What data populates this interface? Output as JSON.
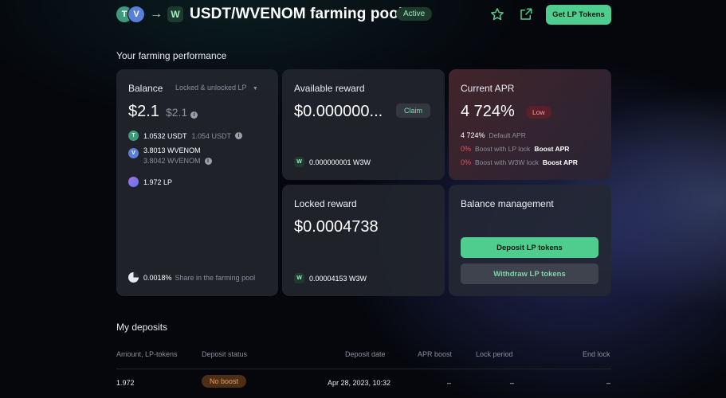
{
  "header": {
    "token_a": "T",
    "token_b": "V",
    "token_target": "W",
    "title": "USDT/WVENOM farming pool",
    "status": "Active",
    "get_lp_label": "Get LP Tokens",
    "icons": [
      "star-icon",
      "external-link-icon"
    ]
  },
  "performance": {
    "section_title": "Your farming performance",
    "balance": {
      "title": "Balance",
      "filter_label": "Locked & unlocked LP",
      "value": "$2.1",
      "value_secondary": "$2.1",
      "usdt_amount": "1.0532 USDT",
      "usdt_secondary": "1.054 USDT",
      "wvenom_amount": "3.8013 WVENOM",
      "wvenom_secondary": "3.8042 WVENOM",
      "lp_amount": "1.972 LP",
      "share_value": "0.0018%",
      "share_label": "Share in the farming pool"
    },
    "available_reward": {
      "title": "Available reward",
      "value": "$0.000000...",
      "claim_label": "Claim",
      "token_amount": "0.000000001 W3W"
    },
    "current_apr": {
      "title": "Current APR",
      "value": "4 724%",
      "level": "Low",
      "default_value": "4 724%",
      "default_label": "Default APR",
      "lp_boost_value": "0%",
      "lp_boost_label": "Boost with LP lock",
      "lp_boost_link": "Boost APR",
      "w3w_boost_value": "0%",
      "w3w_boost_label": "Boost with W3W lock",
      "w3w_boost_link": "Boost APR"
    },
    "locked_reward": {
      "title": "Locked reward",
      "value": "$0.0004738",
      "token_amount": "0.00004153 W3W"
    },
    "balance_management": {
      "title": "Balance management",
      "deposit_label": "Deposit LP tokens",
      "withdraw_label": "Withdraw LP tokens"
    }
  },
  "deposits": {
    "section_title": "My deposits",
    "columns": [
      "Amount, LP-tokens",
      "Deposit status",
      "Deposit date",
      "APR boost",
      "Lock period",
      "End lock"
    ],
    "rows": [
      {
        "amount": "1.972",
        "status": "No boost",
        "date": "Apr 28, 2023, 10:32",
        "apr_boost": "–",
        "lock_period": "–",
        "end_lock": "–"
      }
    ]
  },
  "colors": {
    "accent": "#4fcd8f",
    "card": "#22252c",
    "danger": "#e0525f"
  }
}
